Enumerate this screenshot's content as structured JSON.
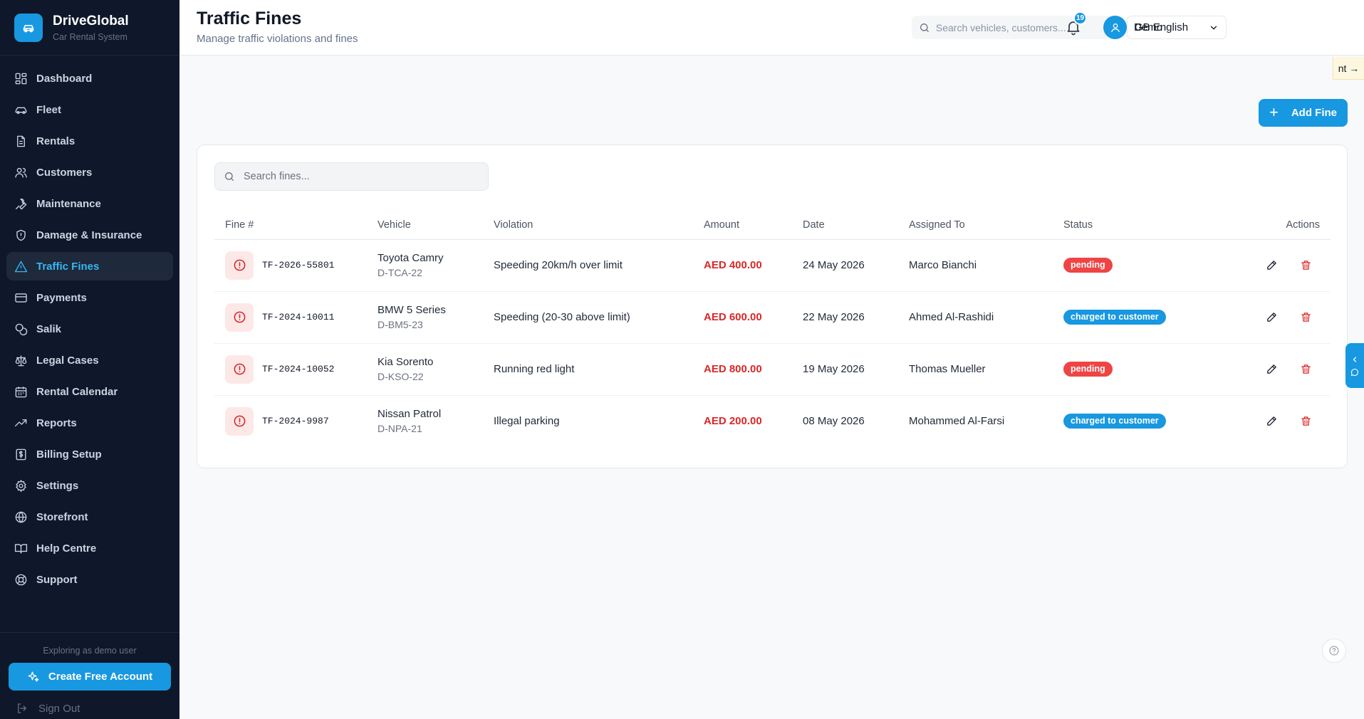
{
  "brand": {
    "name": "DriveGlobal",
    "subtitle": "Car Rental System"
  },
  "sidebar": {
    "items": [
      {
        "label": "Dashboard",
        "icon": "dashboard-icon",
        "active": false
      },
      {
        "label": "Fleet",
        "icon": "car-icon",
        "active": false
      },
      {
        "label": "Rentals",
        "icon": "document-icon",
        "active": false
      },
      {
        "label": "Customers",
        "icon": "users-icon",
        "active": false
      },
      {
        "label": "Maintenance",
        "icon": "wrench-icon",
        "active": false
      },
      {
        "label": "Damage & Insurance",
        "icon": "shield-icon",
        "active": false
      },
      {
        "label": "Traffic Fines",
        "icon": "alert-triangle-icon",
        "active": true
      },
      {
        "label": "Payments",
        "icon": "credit-card-icon",
        "active": false
      },
      {
        "label": "Salik",
        "icon": "coins-icon",
        "active": false
      },
      {
        "label": "Legal Cases",
        "icon": "scale-icon",
        "active": false
      },
      {
        "label": "Rental Calendar",
        "icon": "calendar-icon",
        "active": false
      },
      {
        "label": "Reports",
        "icon": "trending-up-icon",
        "active": false
      },
      {
        "label": "Billing Setup",
        "icon": "receipt-icon",
        "active": false
      },
      {
        "label": "Settings",
        "icon": "gear-icon",
        "active": false
      },
      {
        "label": "Storefront",
        "icon": "globe-icon",
        "active": false
      },
      {
        "label": "Help Centre",
        "icon": "book-icon",
        "active": false
      },
      {
        "label": "Support",
        "icon": "lifebuoy-icon",
        "active": false
      }
    ],
    "demo_note": "Exploring as demo user",
    "create_account_label": "Create Free Account",
    "sign_out_label": "Sign Out"
  },
  "header": {
    "title": "Traffic Fines",
    "subtitle": "Manage traffic violations and fines",
    "search_placeholder": "Search vehicles, customers...",
    "language": "GB English",
    "notification_count": "19",
    "user_name": "Demo"
  },
  "tour_tab": {
    "label": "nt →"
  },
  "toolbar": {
    "add_label": "Add Fine"
  },
  "fines": {
    "search_placeholder": "Search fines...",
    "columns": [
      "Fine #",
      "Vehicle",
      "Violation",
      "Amount",
      "Date",
      "Assigned To",
      "Status",
      "Actions"
    ],
    "rows": [
      {
        "fine_no": "TF-2026-55801",
        "vehicle": "Toyota Camry",
        "plate": "D-TCA-22",
        "violation": "Speeding 20km/h over limit",
        "amount": "AED 400.00",
        "date": "24 May 2026",
        "assigned_to": "Marco Bianchi",
        "status": "pending"
      },
      {
        "fine_no": "TF-2024-10011",
        "vehicle": "BMW 5 Series",
        "plate": "D-BM5-23",
        "violation": "Speeding (20-30 above limit)",
        "amount": "AED 600.00",
        "date": "22 May 2026",
        "assigned_to": "Ahmed Al-Rashidi",
        "status": "charged to customer"
      },
      {
        "fine_no": "TF-2024-10052",
        "vehicle": "Kia Sorento",
        "plate": "D-KSO-22",
        "violation": "Running red light",
        "amount": "AED 800.00",
        "date": "19 May 2026",
        "assigned_to": "Thomas Mueller",
        "status": "pending"
      },
      {
        "fine_no": "TF-2024-9987",
        "vehicle": "Nissan Patrol",
        "plate": "D-NPA-21",
        "violation": "Illegal parking",
        "amount": "AED 200.00",
        "date": "08 May 2026",
        "assigned_to": "Mohammed Al-Farsi",
        "status": "charged to customer"
      }
    ]
  },
  "colors": {
    "accent": "#1798e0",
    "sidebar_bg": "#0f172a",
    "danger": "#dc2626",
    "pending": "#ef4444",
    "charged": "#1798e0"
  }
}
